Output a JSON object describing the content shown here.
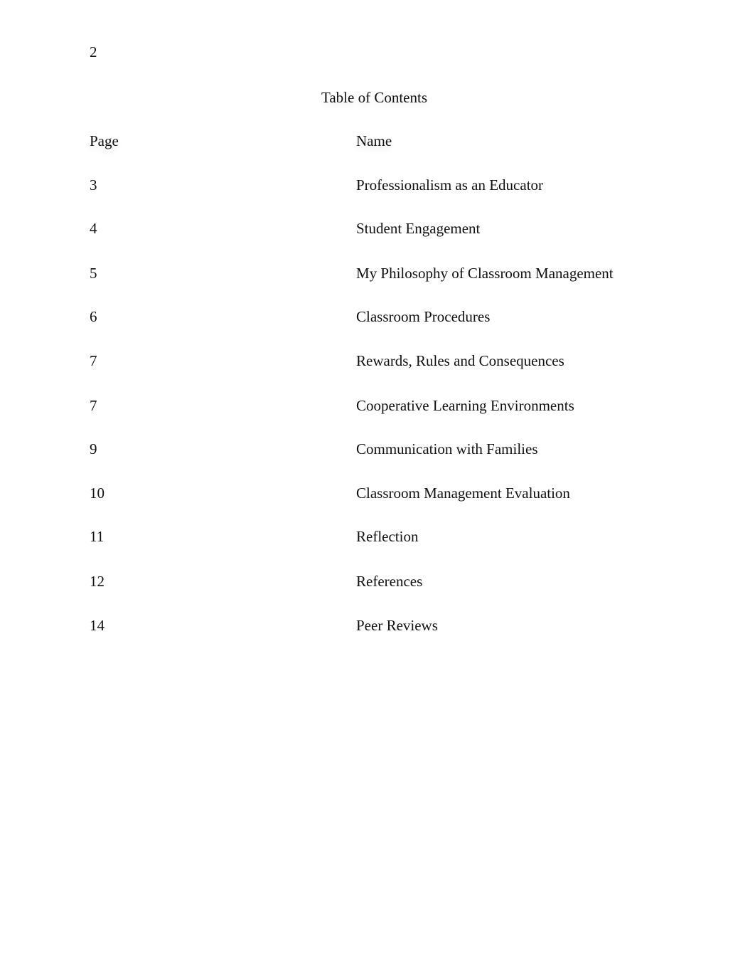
{
  "document": {
    "page_number": "2",
    "title": "Table of Contents",
    "columns": {
      "page": "Page",
      "name": "Name"
    },
    "entries": [
      {
        "page": "3",
        "name": "Professionalism as an Educator"
      },
      {
        "page": "4",
        "name": "Student Engagement"
      },
      {
        "page": "5",
        "name": "My Philosophy of Classroom Management"
      },
      {
        "page": "6",
        "name": "Classroom Procedures"
      },
      {
        "page": "7",
        "name": "Rewards, Rules and Consequences"
      },
      {
        "page": "7",
        "name": "Cooperative Learning Environments"
      },
      {
        "page": "9",
        "name": "Communication with Families"
      },
      {
        "page": "10",
        "name": "Classroom Management Evaluation"
      },
      {
        "page": "11",
        "name": "Reflection"
      },
      {
        "page": "12",
        "name": "References"
      },
      {
        "page": "14",
        "name": "Peer Reviews"
      }
    ]
  }
}
